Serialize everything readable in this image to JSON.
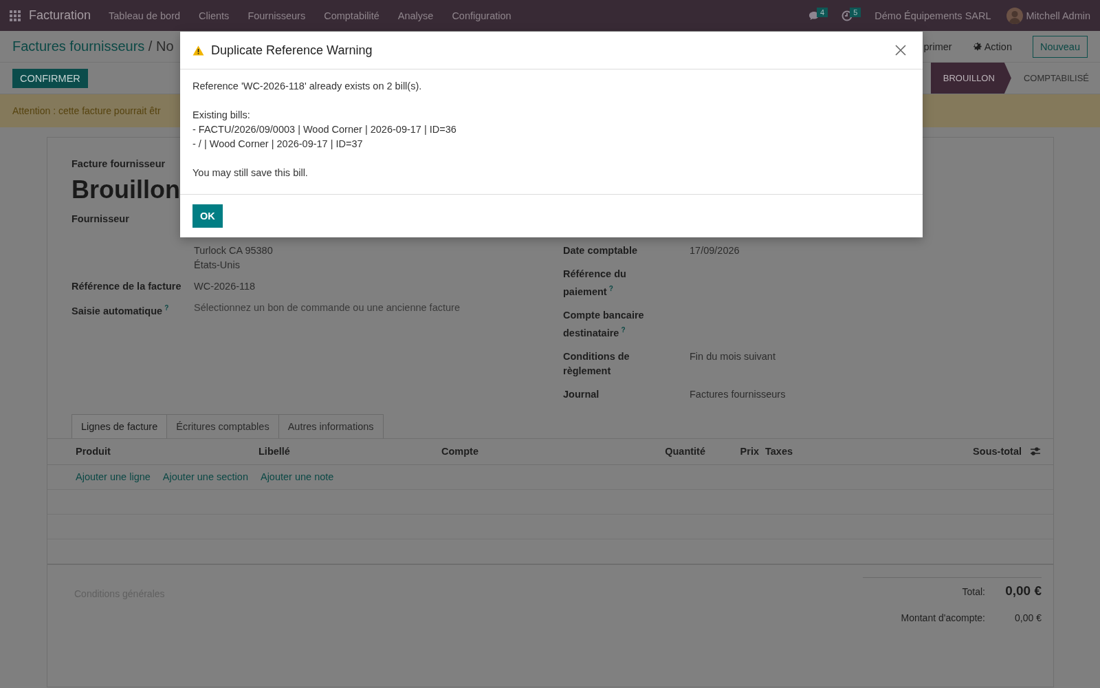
{
  "navbar": {
    "app_name": "Facturation",
    "menu": [
      "Tableau de bord",
      "Clients",
      "Fournisseurs",
      "Comptabilité",
      "Analyse",
      "Configuration"
    ],
    "messages_badge": "4",
    "activities_badge": "5",
    "company": "Démo Équipements SARL",
    "user": "Mitchell Admin"
  },
  "breadcrumb": {
    "parent": "Factures fournisseurs",
    "separator": "/",
    "current": "No"
  },
  "toolbar": {
    "print": "primer",
    "action": "Action",
    "new": "Nouveau"
  },
  "confirm_button": "CONFIRMER",
  "status_stages": [
    {
      "label": "BROUILLON",
      "selected": true
    },
    {
      "label": "COMPTABILISÉ",
      "selected": false
    }
  ],
  "alert": "Attention : cette facture pourrait êtr",
  "form": {
    "type_label": "Facture fournisseur",
    "title": "Brouillon",
    "left_fields": [
      {
        "label": "Fournisseur",
        "lines": [
          "Turlock CA 95380",
          "États-Unis"
        ]
      },
      {
        "label": "Référence de la facture",
        "value": "WC-2026-118"
      },
      {
        "label": "Saisie automatique",
        "help": "?",
        "placeholder": "Sélectionnez un bon de commande ou une ancienne facture"
      }
    ],
    "right_fields": [
      {
        "label": "Date comptable",
        "value": "17/09/2026"
      },
      {
        "label": "Référence du paiement",
        "help": "?"
      },
      {
        "label": "Compte bancaire destinataire",
        "help": "?"
      },
      {
        "label": "Conditions de règlement",
        "value": "Fin du mois suivant"
      },
      {
        "label": "Journal",
        "value": "Factures fournisseurs"
      }
    ]
  },
  "tabs": [
    {
      "label": "Lignes de facture",
      "selected": true
    },
    {
      "label": "Écritures comptables",
      "selected": false
    },
    {
      "label": "Autres informations",
      "selected": false
    }
  ],
  "lines_table": {
    "columns": [
      "Produit",
      "Libellé",
      "Compte",
      "Quantité",
      "Prix",
      "Taxes",
      "Sous-total"
    ],
    "add_links": [
      "Ajouter une ligne",
      "Ajouter une section",
      "Ajouter une note"
    ]
  },
  "terms_placeholder": "Conditions générales",
  "totals": [
    {
      "kind": "total",
      "label": "Total:",
      "value": "0,00 €"
    },
    {
      "kind": "sub",
      "label": "Montant d'acompte:",
      "value": "0,00 €"
    }
  ],
  "dialog": {
    "title": "Duplicate Reference Warning",
    "paragraphs": [
      [
        "Reference 'WC-2026-118' already exists on 2 bill(s)."
      ],
      [
        "Existing bills:",
        "- FACTU/2026/09/0003 | Wood Corner | 2026-09-17 | ID=36",
        "- / | Wood Corner | 2026-09-17 | ID=37"
      ],
      [
        "You may still save this bill."
      ]
    ],
    "ok": "OK"
  }
}
